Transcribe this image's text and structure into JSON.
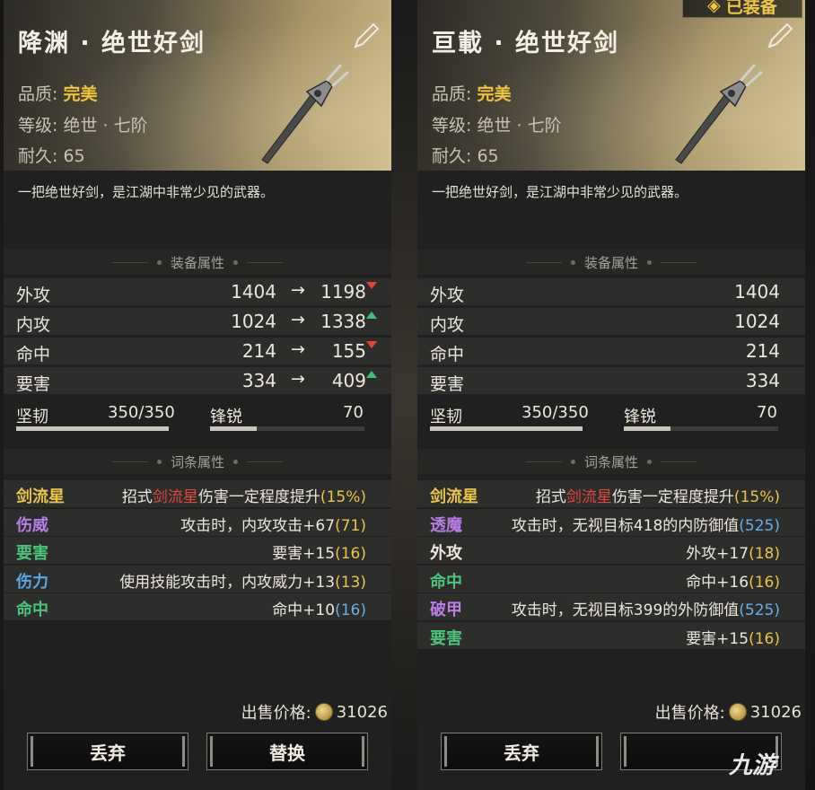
{
  "badge": {
    "icon": "diamond-icon",
    "label": "已装备"
  },
  "left": {
    "title": "降渊 · 绝世好剑",
    "quality_label": "品质:",
    "quality_value": "完美",
    "grade_label": "等级:",
    "grade_value": "绝世 · 七阶",
    "durability_label": "耐久:",
    "durability_value": "65",
    "description": "一把绝世好剑，是江湖中非常少见的武器。",
    "attr_section": "装备属性",
    "attrs": [
      {
        "name": "外攻",
        "from": "1404",
        "arrow": "→",
        "to": "1198",
        "trend": "down"
      },
      {
        "name": "内攻",
        "from": "1024",
        "arrow": "→",
        "to": "1338",
        "trend": "up"
      },
      {
        "name": "命中",
        "from": "214",
        "arrow": "→",
        "to": "155",
        "trend": "down"
      },
      {
        "name": "要害",
        "from": "334",
        "arrow": "→",
        "to": "409",
        "trend": "up"
      }
    ],
    "toughness_label": "坚韧",
    "toughness_value": "350/350",
    "toughness_fraction": 1.0,
    "sharp_label": "锋锐",
    "sharp_value": "70",
    "sharp_fraction": 0.3,
    "affix_section": "词条属性",
    "affixes": [
      {
        "name": "剑流星",
        "color": "#e8c54a",
        "pre": "招式",
        "red": "剑流星",
        "mid": "伤害一定程度提升",
        "open": "(",
        "num": "15%",
        "close": ")",
        "numcolor": "yellow"
      },
      {
        "name": "伤威",
        "color": "#b77ee6",
        "pre": "攻击时，内攻攻击+67",
        "red": "",
        "mid": "",
        "open": "(",
        "num": "71",
        "close": ")",
        "numcolor": "yellow"
      },
      {
        "name": "要害",
        "color": "#4cc27a",
        "pre": "要害+15",
        "red": "",
        "mid": "",
        "open": "(",
        "num": "16",
        "close": ")",
        "numcolor": "yellow"
      },
      {
        "name": "伤力",
        "color": "#5aa6e6",
        "pre": "使用技能攻击时，内攻威力+13",
        "red": "",
        "mid": "",
        "open": "(",
        "num": "13",
        "close": ")",
        "numcolor": "yellow"
      },
      {
        "name": "命中",
        "color": "#4cc27a",
        "pre": "命中+10",
        "red": "",
        "mid": "",
        "open": "(",
        "num": "16",
        "close": ")",
        "numcolor": "blue"
      }
    ],
    "price_label": "出售价格:",
    "price_value": "31026",
    "btn1": "丢弃",
    "btn2": "替换"
  },
  "right": {
    "title": "亘載 · 绝世好剑",
    "quality_label": "品质:",
    "quality_value": "完美",
    "grade_label": "等级:",
    "grade_value": "绝世 · 七阶",
    "durability_label": "耐久:",
    "durability_value": "65",
    "description": "一把绝世好剑，是江湖中非常少见的武器。",
    "attr_section": "装备属性",
    "attrs": [
      {
        "name": "外攻",
        "value": "1404"
      },
      {
        "name": "内攻",
        "value": "1024"
      },
      {
        "name": "命中",
        "value": "214"
      },
      {
        "name": "要害",
        "value": "334"
      }
    ],
    "toughness_label": "坚韧",
    "toughness_value": "350/350",
    "toughness_fraction": 1.0,
    "sharp_label": "锋锐",
    "sharp_value": "70",
    "sharp_fraction": 0.3,
    "affix_section": "词条属性",
    "affixes": [
      {
        "name": "剑流星",
        "color": "#e8c54a",
        "pre": "招式",
        "red": "剑流星",
        "mid": "伤害一定程度提升",
        "open": "(",
        "num": "15%",
        "close": ")",
        "numcolor": "yellow"
      },
      {
        "name": "透魔",
        "color": "#b77ee6",
        "pre": "攻击时，无视目标418的内防御值",
        "red": "",
        "mid": "",
        "open": "(",
        "num": "525",
        "close": ")",
        "numcolor": "blue"
      },
      {
        "name": "外攻",
        "color": "#ece7dc",
        "pre": "外攻+17",
        "red": "",
        "mid": "",
        "open": "(",
        "num": "18",
        "close": ")",
        "numcolor": "yellow"
      },
      {
        "name": "命中",
        "color": "#4cc27a",
        "pre": "命中+16",
        "red": "",
        "mid": "",
        "open": "(",
        "num": "16",
        "close": ")",
        "numcolor": "yellow"
      },
      {
        "name": "破甲",
        "color": "#b77ee6",
        "pre": "攻击时，无视目标399的外防御值",
        "red": "",
        "mid": "",
        "open": "(",
        "num": "525",
        "close": ")",
        "numcolor": "blue"
      },
      {
        "name": "要害",
        "color": "#4cc27a",
        "pre": "要害+15",
        "red": "",
        "mid": "",
        "open": "(",
        "num": "16",
        "close": ")",
        "numcolor": "yellow"
      }
    ],
    "price_label": "出售价格:",
    "price_value": "31026",
    "btn1": "丢弃",
    "btn2": ""
  },
  "logo": "九游"
}
